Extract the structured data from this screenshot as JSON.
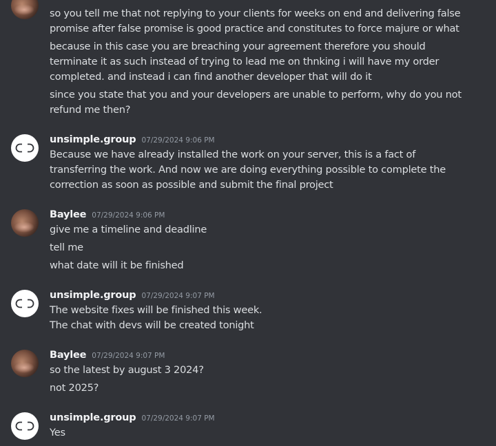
{
  "messages_top": [
    "so you tell me that not replying to your clients for weeks on end and delivering false promise after false promise is good practice and constitutes to force majure or what",
    "because in this case you are breaching your agreement therefore you should terminate it as such instead of trying to lead me on thnking i will have my order completed. and instead i can find another developer that will do it",
    "since you state that you and your developers are unable to perform, why do you not refund me then?"
  ],
  "groups": [
    {
      "username": "unsimple.group",
      "timestamp": "07/29/2024 9:06 PM",
      "avatar_icon": "chain-link-icon",
      "messages": [
        "Because we have already installed the work on your server, this is a fact of transferring the work. And now we are doing everything possible to complete the correction as soon as possible and submit the final project"
      ]
    },
    {
      "username": "Baylee",
      "timestamp": "07/29/2024 9:06 PM",
      "avatar_icon": "user-photo",
      "messages": [
        "give me a timeline and deadline",
        "tell me",
        "what date will it be finished"
      ]
    },
    {
      "username": "unsimple.group",
      "timestamp": "07/29/2024 9:07 PM",
      "avatar_icon": "chain-link-icon",
      "messages": [
        "The website fixes will be finished this week.",
        "The chat with devs will be created tonight"
      ]
    },
    {
      "username": "Baylee",
      "timestamp": "07/29/2024 9:07 PM",
      "avatar_icon": "user-photo",
      "messages": [
        "so the latest by august 3 2024?",
        "not 2025?"
      ]
    },
    {
      "username": "unsimple.group",
      "timestamp": "07/29/2024 9:07 PM",
      "avatar_icon": "chain-link-icon",
      "messages": [
        "Yes"
      ]
    }
  ],
  "colors": {
    "background": "#313338",
    "username": "#f2f3f5",
    "message_text": "#dbdee1",
    "timestamp": "#949ba4"
  }
}
